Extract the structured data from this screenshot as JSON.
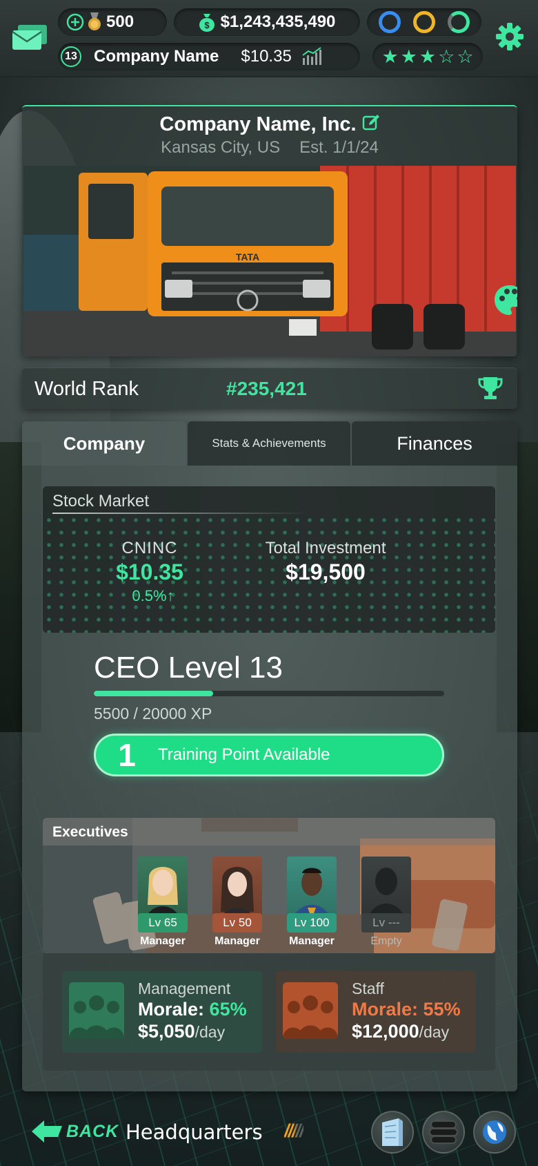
{
  "hud": {
    "credits": "500",
    "cash": "$1,243,435,490",
    "company_level": "13",
    "company_name": "Company Name",
    "share_price": "$10.35",
    "stars_filled": 3,
    "stars_total": 5,
    "rings": [
      {
        "name": "blue-ring-icon",
        "color": "#3a8df0"
      },
      {
        "name": "gold-ring-icon",
        "color": "#f0b429"
      },
      {
        "name": "green-ring-icon",
        "color": "#3ee6a0"
      }
    ]
  },
  "company": {
    "title": "Company Name, Inc.",
    "location": "Kansas City, US",
    "established": "Est. 1/1/24"
  },
  "rank": {
    "label": "World Rank",
    "value": "#235,421"
  },
  "tabs": [
    {
      "label": "Company",
      "active": true
    },
    {
      "label": "Stats & Achievements",
      "active": false
    },
    {
      "label": "Finances",
      "active": false
    }
  ],
  "stock": {
    "title": "Stock Market",
    "ticker": "CNINC",
    "price": "$10.35",
    "change": "0.5%",
    "investment_label": "Total Investment",
    "investment_value": "$19,500"
  },
  "ceo": {
    "title": "CEO Level 13",
    "xp_text": "5500 / 20000 XP",
    "xp_fraction": 0.34,
    "training_count": "1",
    "training_label": "Training Point Available"
  },
  "executives": {
    "title": "Executives",
    "slots": [
      {
        "level": "Lv 65",
        "role": "Manager",
        "accent": "#2e9a6c"
      },
      {
        "level": "Lv 50",
        "role": "Manager",
        "accent": "#a4553a"
      },
      {
        "level": "Lv 100",
        "role": "Manager",
        "accent": "#2f9c82"
      },
      {
        "level": "Lv ---",
        "role": "Empty",
        "accent": "#3a3f3f"
      }
    ]
  },
  "morale": {
    "management": {
      "name": "Management",
      "morale_label": "Morale:",
      "morale_value": "65%",
      "pay": "$5,050",
      "pay_unit": "/day",
      "color": "#3ee6a0"
    },
    "staff": {
      "name": "Staff",
      "morale_label": "Morale:",
      "morale_value": "55%",
      "pay": "$12,000",
      "pay_unit": "/day",
      "color": "#f07a45"
    }
  },
  "bottom": {
    "back_label": "BACK",
    "location": "Headquarters",
    "slashes": "/////"
  }
}
